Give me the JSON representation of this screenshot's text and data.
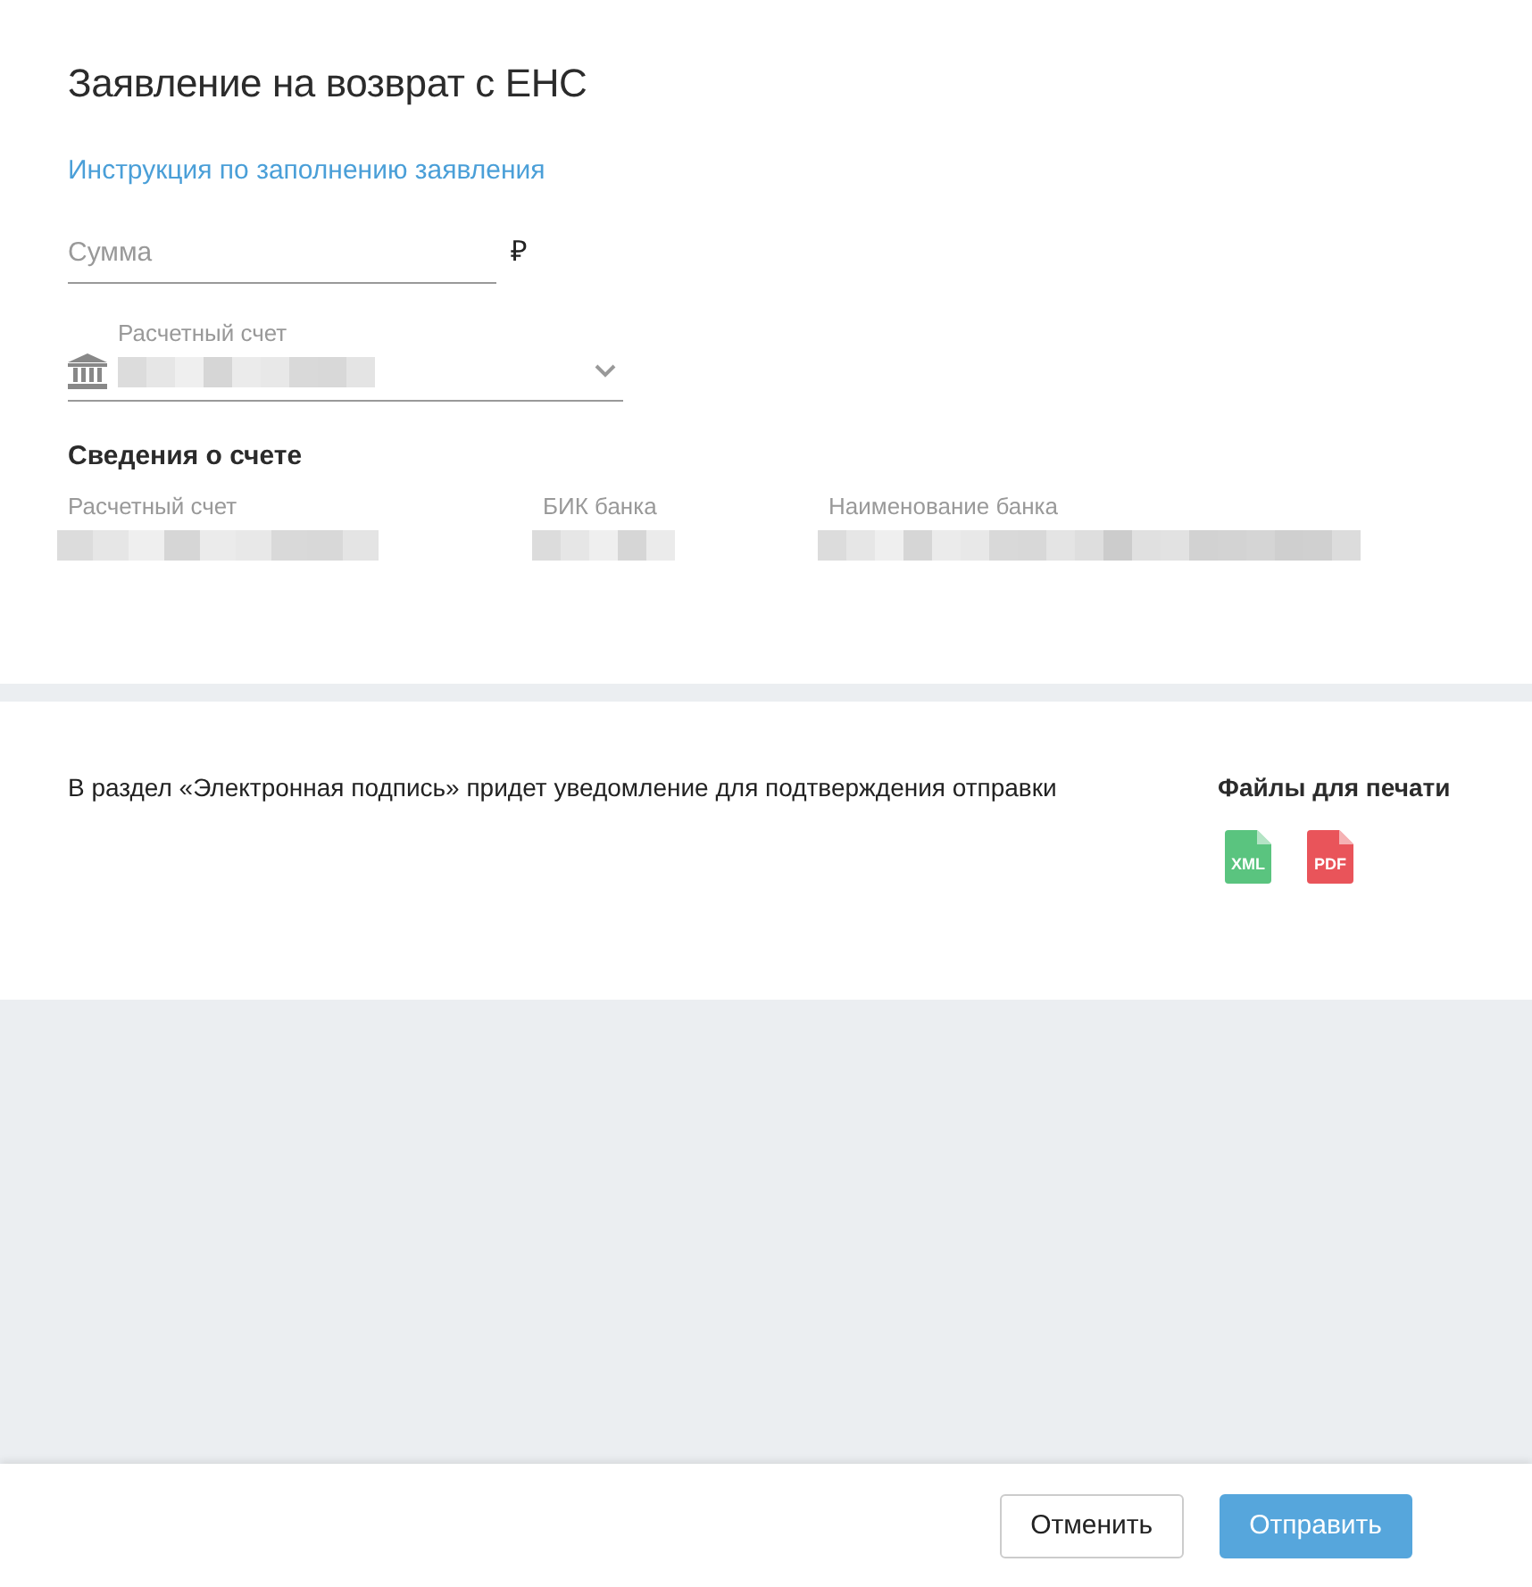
{
  "title": "Заявление на возврат с ЕНС",
  "instruction_link": "Инструкция по заполнению заявления",
  "amount_field": {
    "placeholder": "Сумма",
    "currency": "₽"
  },
  "account_select": {
    "label": "Расчетный счет"
  },
  "account_info": {
    "heading": "Сведения о счете",
    "columns": [
      {
        "label": "Расчетный счет"
      },
      {
        "label": "БИК банка"
      },
      {
        "label": "Наименование банка"
      }
    ]
  },
  "notice": "В раздел «Электронная подпись» придет уведомление для подтверждения отправки",
  "print_files": {
    "heading": "Файлы для печати",
    "files": [
      {
        "label": "XML",
        "color": "#5ac47f"
      },
      {
        "label": "PDF",
        "color": "#e9545a"
      }
    ]
  },
  "buttons": [
    {
      "label": "Отменить",
      "kind": "secondary"
    },
    {
      "label": "Отправить",
      "kind": "primary"
    }
  ]
}
